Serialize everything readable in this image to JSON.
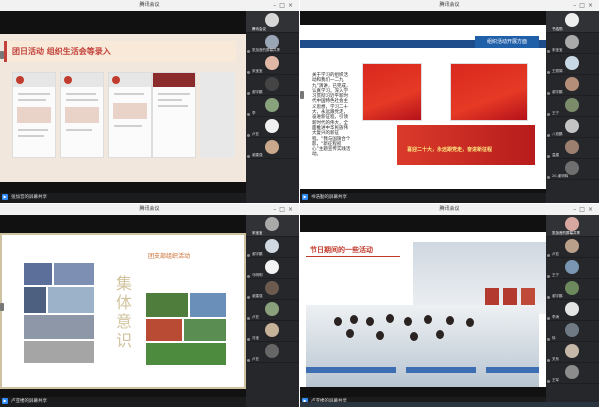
{
  "windows": [
    {
      "title": "腾讯会议",
      "share_text": "张加音的屏幕共享",
      "slide": {
        "title": "团日活动 组织生活会等录入"
      },
      "participants": [
        "腾讯会议",
        "张加音的屏幕共享",
        "宋宝宝",
        "谢宇鹏",
        "李",
        "卢亚",
        "谢建强"
      ]
    },
    {
      "title": "腾讯会议",
      "share_text": "书浩勤的屏幕共享",
      "slide": {
        "title": "组织活动开展方面",
        "paragraph": "关于学习的组织活动和我们一二九九”演讲，已完成，认真学习。深入学习贯彻习近平新时代中国特色社会主义思想，学习二十大，永远跟党走，奋进新征程，引领新时代的伟大，全面推进中华民族伟大复兴的新征程。“我与国旗合个影，“新征程初心”主题宣传实践活动。",
        "banner": "喜迎二十大，永远跟党走，奋进新征程"
      },
      "participants": [
        "书浩勤",
        "宋宝宝",
        "王丽娟",
        "谢宇鹏",
        "王宁",
        "八班鹏",
        "温建",
        "20-谢明辉"
      ]
    },
    {
      "title": "腾讯会议",
      "share_text": "卢亚楼的屏幕共享",
      "slide": {
        "title": "团支部组织活动",
        "vertical": "集体意识"
      },
      "participants": [
        "宋宝宝",
        "谢宇鹏",
        "马明明",
        "谢建强",
        "卢亚",
        "冯宝",
        "卢亚"
      ]
    },
    {
      "title": "腾讯会议",
      "share_text": "卢亚楼的屏幕共享",
      "slide": {
        "title": "节日期间的一些活动"
      },
      "participants": [
        "张加音的屏幕共享",
        "卢亚",
        "王宁",
        "谢宇鹏",
        "李涛",
        "徐",
        "关系",
        "王军"
      ]
    }
  ]
}
